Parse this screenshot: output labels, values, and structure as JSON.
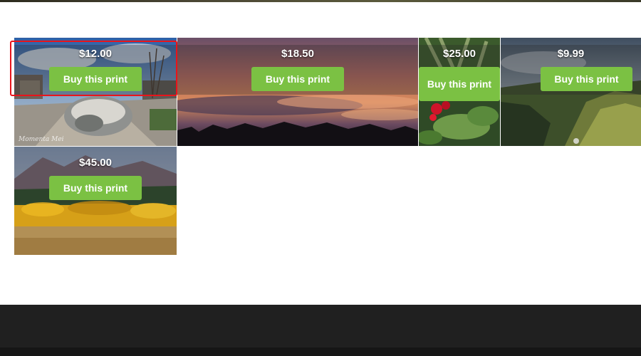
{
  "gallery": {
    "items": [
      {
        "price": "$12.00",
        "button_label": "Buy this print"
      },
      {
        "price": "$18.50",
        "button_label": "Buy this print"
      },
      {
        "price": "$25.00",
        "button_label": "Buy this print"
      },
      {
        "price": "$9.99",
        "button_label": "Buy this print"
      },
      {
        "price": "$45.00",
        "button_label": "Buy this print"
      }
    ]
  },
  "colors": {
    "button_green": "#7bc143",
    "highlight_red": "#e8141b",
    "footer_dark": "#202020"
  }
}
